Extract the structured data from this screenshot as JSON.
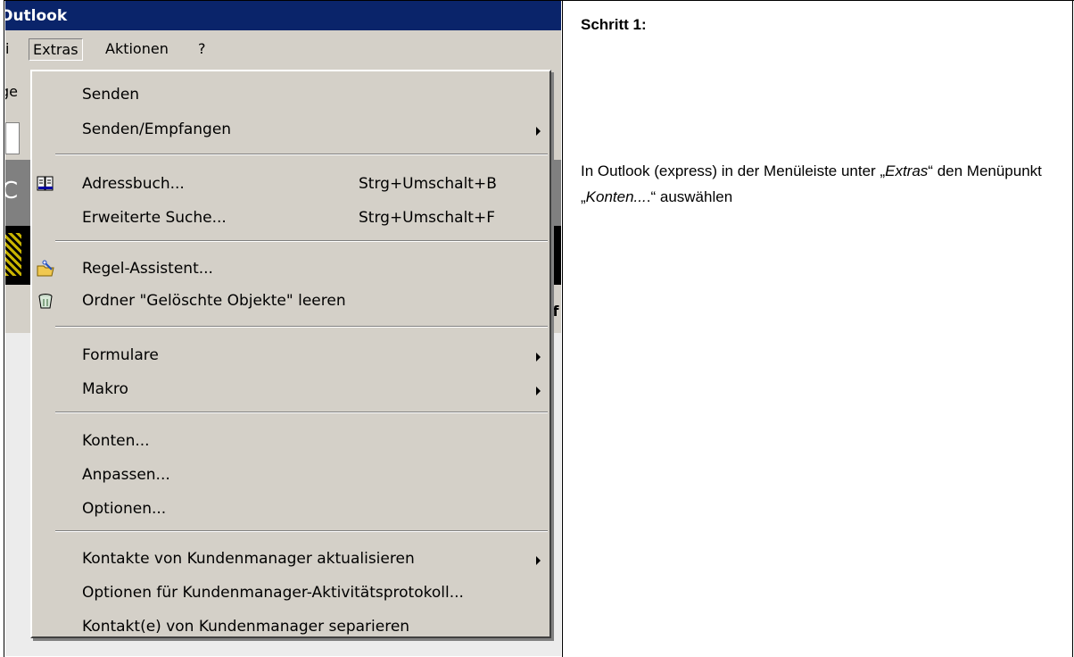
{
  "screenshot": {
    "window_title": "Outlook",
    "menubar": {
      "items": [
        "Extras",
        "Aktionen",
        "?"
      ],
      "partial_left": "i",
      "active": "Extras"
    },
    "background_fragments": {
      "toolbar_left": "ge",
      "grey_left": "C",
      "right_frag": "if"
    },
    "menu": {
      "items": [
        {
          "label": "Senden",
          "shortcut": "",
          "submenu": false
        },
        {
          "label": "Senden/Empfangen",
          "shortcut": "",
          "submenu": true
        },
        {
          "label": "Adressbuch...",
          "shortcut": "Strg+Umschalt+B",
          "submenu": false,
          "icon": "address-book-icon"
        },
        {
          "label": "Erweiterte Suche...",
          "shortcut": "Strg+Umschalt+F",
          "submenu": false
        },
        {
          "label": "Regel-Assistent...",
          "shortcut": "",
          "submenu": false,
          "icon": "rules-wizard-icon"
        },
        {
          "label": "Ordner \"Gelöschte Objekte\" leeren",
          "shortcut": "",
          "submenu": false,
          "icon": "empty-trash-icon"
        },
        {
          "label": "Formulare",
          "shortcut": "",
          "submenu": true
        },
        {
          "label": "Makro",
          "shortcut": "",
          "submenu": true
        },
        {
          "label": "Konten...",
          "shortcut": "",
          "submenu": false
        },
        {
          "label": "Anpassen...",
          "shortcut": "",
          "submenu": false
        },
        {
          "label": "Optionen...",
          "shortcut": "",
          "submenu": false
        },
        {
          "label": "Kontakte von Kundenmanager aktualisieren",
          "shortcut": "",
          "submenu": true
        },
        {
          "label": "Optionen für Kundenmanager-Aktivitätsprotokoll...",
          "shortcut": "",
          "submenu": false
        },
        {
          "label": "Kontakt(e) von Kundenmanager separieren",
          "shortcut": "",
          "submenu": false
        }
      ]
    }
  },
  "instructions": {
    "heading": "Schritt 1:",
    "text_before": "In Outlook (express) in der Menüleiste unter ",
    "quote_open_1": "„",
    "term_1": "Extras",
    "quote_close_1": "“",
    "text_middle": " den Menüpunkt ",
    "quote_open_2": "„",
    "term_2": "Konten...",
    "text_dot": ".",
    "quote_close_2": "“",
    "text_after": " auswählen"
  }
}
